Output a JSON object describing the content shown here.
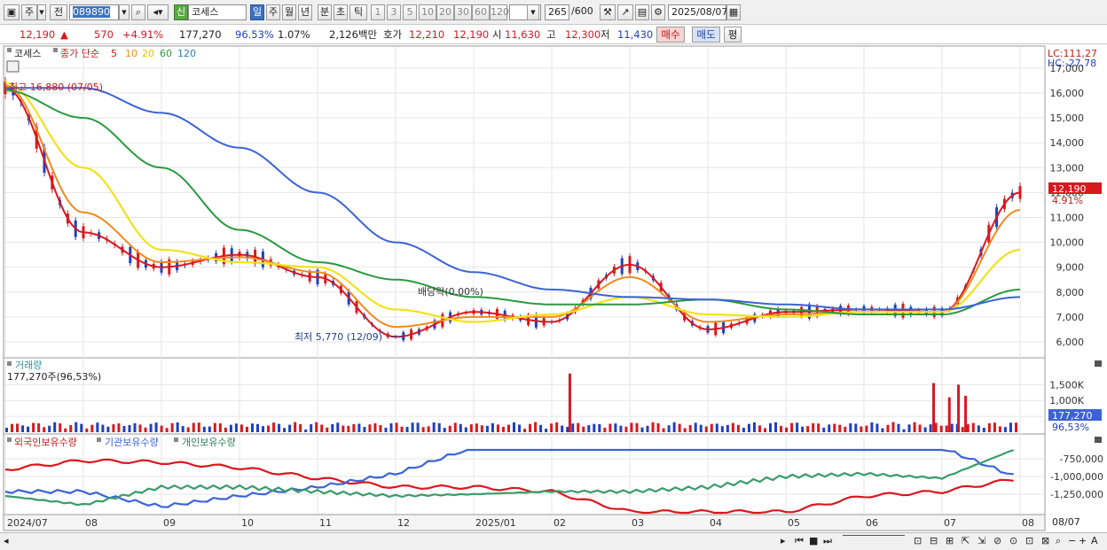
{
  "toolbar": {
    "period_label": "주",
    "prev_label": "전",
    "code_value": "089890",
    "new_badge": "신",
    "name_value": "코세스",
    "tabs": [
      "일",
      "주",
      "월",
      "년",
      "분",
      "초",
      "틱"
    ],
    "nums": [
      "1",
      "3",
      "5",
      "10",
      "20",
      "30",
      "60",
      "120"
    ],
    "count_value": "265",
    "count_total": "/600",
    "date_value": "2025/08/07"
  },
  "quote": {
    "price": "12,190",
    "arrow": "▲",
    "change": "570",
    "change_pct": "+4.91%",
    "volume": "177,270",
    "vol_ratio": "96.53%",
    "turnover": "1.07%",
    "amount": "2,126백만",
    "bid_label": "호가",
    "bid1": "12,210",
    "bid2": "12,190",
    "open_label": "시",
    "open": "11,630",
    "high_label": "고",
    "high": "12,300",
    "low_label": "저",
    "low": "11,430",
    "buy_label": "매수",
    "sell_label": "매도",
    "avg_label": "평"
  },
  "price_panel": {
    "title": "코세스",
    "ma_label": "종가 단순",
    "ma_periods": [
      "5",
      "10",
      "20",
      "60",
      "120"
    ],
    "max_annotation": "최고 16,880 (07/05)",
    "min_annotation": "최저 5,770 (12/09)",
    "dividend_annotation": "배당락(0.00%)",
    "lc": "LC:111,27",
    "hc": "HC:-27,78",
    "current_price": "12,190",
    "current_pct": "4.91%"
  },
  "volume_panel": {
    "title": "거래량",
    "value": "177,270주(96,53%)",
    "current": "177,270",
    "current_pct": "96,53%"
  },
  "holding_panel": {
    "legends": [
      "외국인보유수량",
      "기관보유수량",
      "개인보유수량"
    ]
  },
  "x_axis": {
    "labels": [
      "2024/07",
      "08",
      "09",
      "10",
      "11",
      "12",
      "2025/01",
      "02",
      "03",
      "04",
      "05",
      "06",
      "07",
      "08"
    ],
    "right_label": "08/07"
  },
  "colors": {
    "up": "#d8181f",
    "down": "#1f3fbf",
    "ma5": "#d8181f",
    "ma10": "#f08a1c",
    "ma20": "#f2e21b",
    "ma60": "#2a9a3f",
    "ma120": "#3b63d6",
    "foreign": "#d8181f",
    "institution": "#3b63d6",
    "individual": "#3a9c6a"
  },
  "chart_data": [
    {
      "type": "line",
      "title": "코세스",
      "ylim": [
        5500,
        17600
      ],
      "y_ticks": [
        "17,000",
        "16,000",
        "15,000",
        "14,000",
        "13,000",
        "12,000",
        "11,000",
        "10,000",
        "9,000",
        "8,000",
        "7,000",
        "6,000"
      ],
      "x": [
        "2024/07",
        "08",
        "09",
        "10",
        "11",
        "12",
        "2025/01",
        "02",
        "03",
        "04",
        "05",
        "06",
        "07",
        "08"
      ],
      "series": [
        {
          "name": "5",
          "values": [
            16200,
            10400,
            9000,
            9500,
            8600,
            6200,
            7200,
            6800,
            9100,
            6500,
            7200,
            7300,
            7200,
            12000
          ]
        },
        {
          "name": "10",
          "values": [
            16300,
            11200,
            9200,
            9400,
            8800,
            6600,
            7000,
            7000,
            8600,
            6800,
            7100,
            7200,
            7200,
            11300
          ]
        },
        {
          "name": "20",
          "values": [
            16400,
            13000,
            9700,
            9200,
            9000,
            7300,
            6800,
            7100,
            7800,
            7100,
            7000,
            7200,
            7200,
            9700
          ]
        },
        {
          "name": "60",
          "values": [
            16100,
            15000,
            13000,
            10500,
            9200,
            8500,
            7800,
            7500,
            7500,
            7700,
            7300,
            7100,
            7100,
            8100
          ]
        },
        {
          "name": "120",
          "values": [
            16200,
            16200,
            15200,
            13800,
            12000,
            10000,
            8800,
            8100,
            7800,
            7700,
            7500,
            7300,
            7300,
            7800
          ]
        }
      ]
    },
    {
      "type": "bar",
      "title": "거래량",
      "y_ticks": [
        "1,500K",
        "1,000K",
        "500K"
      ],
      "ylim": [
        0,
        1900000
      ],
      "values": [
        1850000,
        1100000,
        1550000,
        1150000,
        1500000,
        177270
      ]
    },
    {
      "type": "line",
      "y_ticks": [
        "-750,000",
        "-1,000,000",
        "-1,250,000"
      ],
      "series": [
        {
          "name": "외국인보유수량"
        },
        {
          "name": "기관보유수량"
        },
        {
          "name": "개인보유수량"
        }
      ]
    }
  ]
}
